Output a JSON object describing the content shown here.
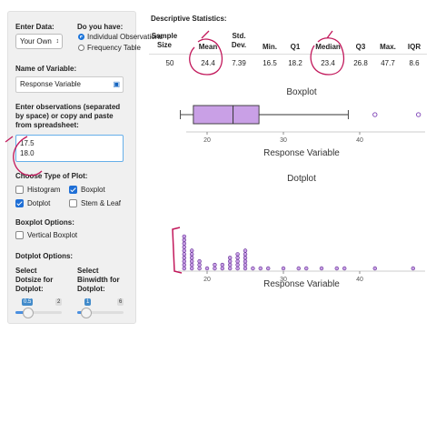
{
  "sidebar": {
    "enter_data_label": "Enter Data:",
    "data_source_value": "Your Own",
    "do_you_have_label": "Do you have:",
    "radio_individual": "Individual Observations",
    "radio_frequency": "Frequency Table",
    "var_name_label": "Name of Variable:",
    "var_name_value": "Response Variable",
    "obs_label_1": "Enter observations (separated",
    "obs_label_2": "by space) or copy and paste",
    "obs_label_3": "from spreadsheet:",
    "obs_line_1": "17.5",
    "obs_line_2": "18.0",
    "plot_type_label": "Choose Type of Plot:",
    "cb_histogram": "Histogram",
    "cb_boxplot": "Boxplot",
    "cb_dotplot": "Dotplot",
    "cb_stemleaf": "Stem & Leaf",
    "boxplot_options_label": "Boxplot Options:",
    "cb_vertical": "Vertical Boxplot",
    "dotplot_options_label": "Dotplot Options:",
    "dotsize_label_1": "Select",
    "dotsize_label_2": "Dotsize for",
    "dotsize_label_3": "Dotplot:",
    "dotsize_value": "0.5",
    "dotsize_max": "2",
    "binwidth_label_1": "Select",
    "binwidth_label_2": "Binwidth for",
    "binwidth_label_3": "Dotplot:",
    "binwidth_value": "1",
    "binwidth_max": "6"
  },
  "stats": {
    "title": "Descriptive Statistics:",
    "headers": [
      "Sample Size",
      "Mean",
      "Std. Dev.",
      "Min.",
      "Q1",
      "Median",
      "Q3",
      "Max.",
      "IQR"
    ],
    "values": [
      "50",
      "24.4",
      "7.39",
      "16.5",
      "18.2",
      "23.4",
      "26.8",
      "47.7",
      "8.6"
    ]
  },
  "chart_data": [
    {
      "type": "boxplot",
      "title": "Boxplot",
      "xlabel": "Response Variable",
      "x_ticks": [
        20,
        30,
        40
      ],
      "whisker_low": 16.5,
      "q1": 18.2,
      "median": 23.4,
      "q3": 26.8,
      "whisker_high": 38.5,
      "outliers": [
        42,
        47.7
      ]
    },
    {
      "type": "dotplot",
      "title": "Dotplot",
      "xlabel": "Response Variable",
      "x_ticks": [
        20,
        30,
        40
      ],
      "bins": [
        {
          "x": 17,
          "count": 10
        },
        {
          "x": 18,
          "count": 6
        },
        {
          "x": 19,
          "count": 3
        },
        {
          "x": 20,
          "count": 1
        },
        {
          "x": 21,
          "count": 2
        },
        {
          "x": 22,
          "count": 2
        },
        {
          "x": 23,
          "count": 4
        },
        {
          "x": 24,
          "count": 5
        },
        {
          "x": 25,
          "count": 6
        },
        {
          "x": 26,
          "count": 1
        },
        {
          "x": 27,
          "count": 1
        },
        {
          "x": 28,
          "count": 1
        },
        {
          "x": 30,
          "count": 1
        },
        {
          "x": 32,
          "count": 1
        },
        {
          "x": 33,
          "count": 1
        },
        {
          "x": 35,
          "count": 1
        },
        {
          "x": 37,
          "count": 1
        },
        {
          "x": 38,
          "count": 1
        },
        {
          "x": 42,
          "count": 1
        },
        {
          "x": 47,
          "count": 1
        }
      ],
      "dot_color": "#c9a0e6"
    }
  ],
  "annotation_color": "#c2185b"
}
